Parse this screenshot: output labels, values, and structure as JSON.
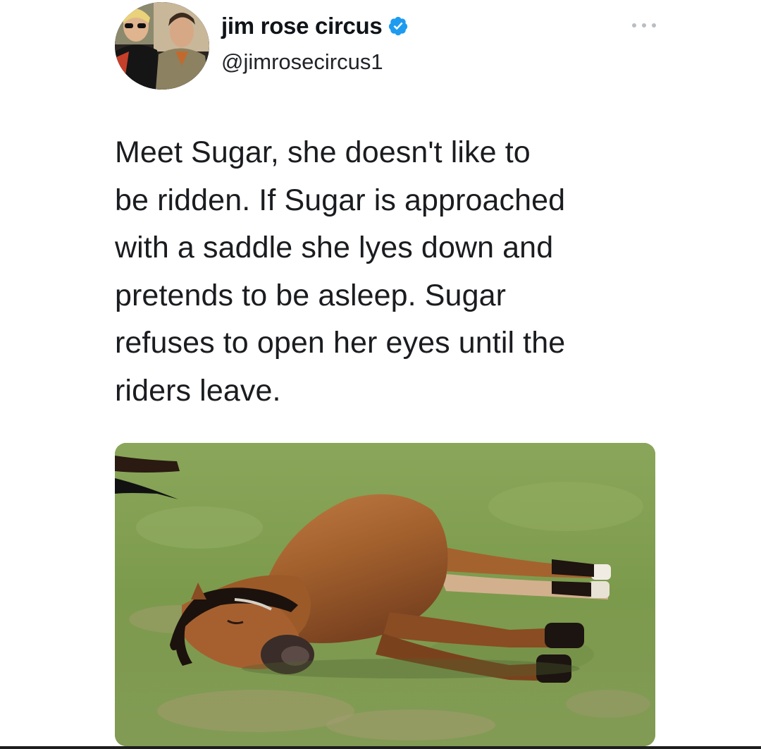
{
  "tweet": {
    "author": {
      "display_name": "jim rose circus",
      "handle": "@jimrosecircus1",
      "verified": true,
      "avatar": "avatar-photo-two-men"
    },
    "menu_icon": "more-dots-icon",
    "text_lines": [
      "Meet Sugar, she doesn't like to",
      "be ridden. If Sugar is approached",
      "with a saddle she lyes down and",
      "pretends to be asleep. Sugar",
      "refuses to open her eyes until the",
      "riders leave."
    ],
    "media": {
      "type": "photo",
      "subject": "horse-lying-on-grass"
    }
  },
  "colors": {
    "verified_badge": "#1d9bf0",
    "text": "#0f1419",
    "grass": "#7d9a4e",
    "horse": "#9a5a2a"
  }
}
